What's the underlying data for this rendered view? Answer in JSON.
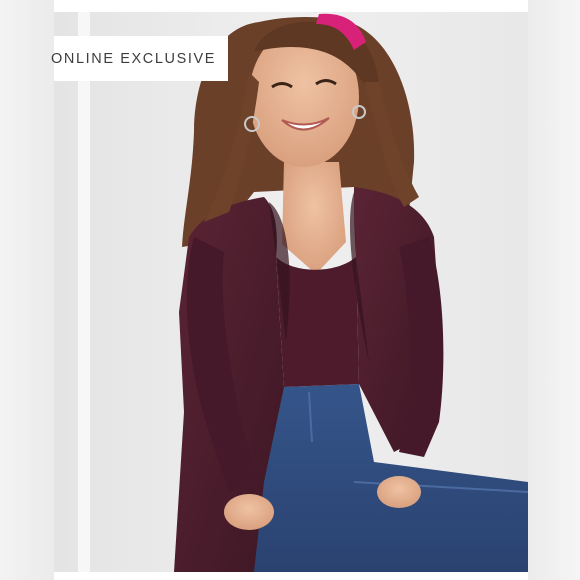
{
  "badge": {
    "label": "ONLINE EXCLUSIVE"
  },
  "product_image": {
    "subject": "smiling woman wearing a burgundy open-front shawl-collar cardigan, matching top and blue jeans, seated",
    "colors": {
      "cardigan": "#4a1c2b",
      "jeans": "#2e4a7a",
      "hair": "#6b4028",
      "headband": "#d8227a",
      "background": "#e9e9e9"
    }
  }
}
